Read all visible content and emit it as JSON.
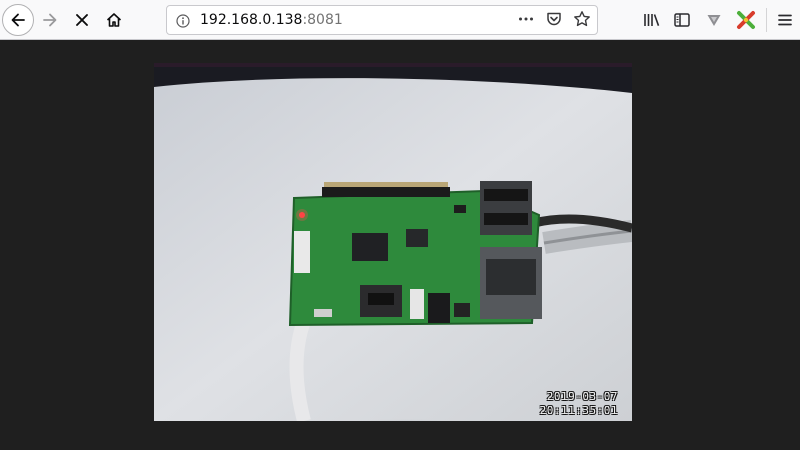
{
  "browser": {
    "url_host": "192.168.0.138",
    "url_port": ":8081",
    "icons": {
      "back": "back-arrow-icon",
      "forward": "forward-arrow-icon",
      "stop": "stop-x-icon",
      "home": "home-icon",
      "info": "info-icon",
      "more": "more-dots-icon",
      "pocket": "pocket-icon",
      "bookmark": "star-icon",
      "library": "library-icon",
      "sidebar": "sidebar-icon",
      "vpn": "vpn-shield-icon",
      "extension": "extension-icon",
      "menu": "hamburger-menu-icon"
    }
  },
  "stream": {
    "timestamp_date": "2019-03-07",
    "timestamp_time": "20:11:35:01"
  },
  "colors": {
    "page_background": "#1f1f1f",
    "toolbar_background": "#f9f9fa",
    "board_green": "#2e8a3c"
  }
}
